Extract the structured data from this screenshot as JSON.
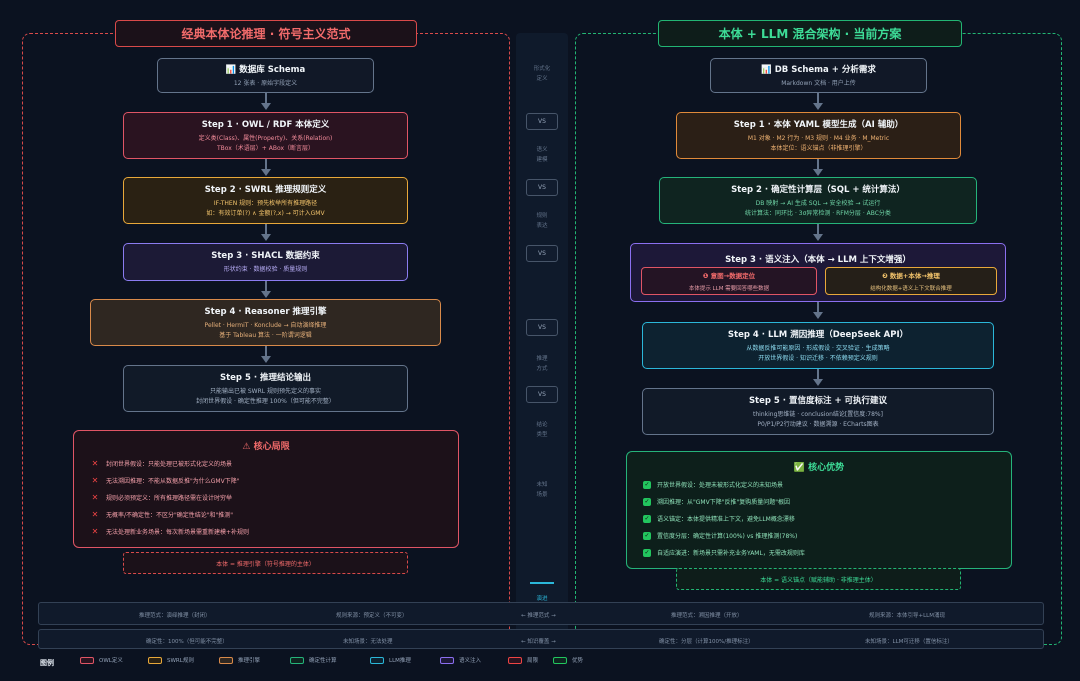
{
  "left": {
    "title": "经典本体论推理 · 符号主义范式",
    "source": {
      "title": "📊 数据库 Schema",
      "sub": "12 张表 · 原始字段定义"
    },
    "steps": [
      {
        "title": "Step 1 · OWL / RDF 本体定义",
        "lines": [
          "定义类(Class)、属性(Property)、关系(Relation)",
          "TBox（术语层）+ ABox（断言层）"
        ]
      },
      {
        "title": "Step 2 · SWRL 推理规则定义",
        "lines": [
          "IF-THEN 规则：预先枚举所有推理路径",
          "如：有效订单(?) ∧ 金额(?,x) → 可计入GMV"
        ]
      },
      {
        "title": "Step 3 · SHACL 数据约束",
        "lines": [
          "形状约束 · 数据校验 · 质量规则"
        ]
      },
      {
        "title": "Step 4 · Reasoner 推理引擎",
        "lines": [
          "Pellet · HermiT · Konclude → 自动演绎推理",
          "基于 Tableau 算法 · 一阶谓词逻辑"
        ]
      },
      {
        "title": "Step 5 · 推理结论输出",
        "lines": [
          "只能输出已被 SWRL 规则预先定义的事实",
          "封闭世界假设 · 确定性推理 100%（但可能不完整）"
        ]
      }
    ],
    "limit": {
      "title": "⚠ 核心局限",
      "items": [
        "封闭世界假设：只能处理已被形式化定义的场景",
        "无法溯因推理：不能从数据反推\"为什么GMV下降\"",
        "规则必须预定义：所有推理路径需在设计时穷举",
        "无概率/不确定性：不区分\"确定性结论\"和\"推测\"",
        "无法处理新业务场景：每次新场景需重新建模+补规则"
      ]
    },
    "footer": "本体 = 推理引擎（符号推理的主体）"
  },
  "right": {
    "title": "本体 + LLM 混合架构 · 当前方案",
    "source": {
      "title": "📊 DB Schema + 分析需求",
      "sub": "Markdown 文档 · 用户上传"
    },
    "steps": [
      {
        "title": "Step 1 · 本体 YAML 模型生成（AI 辅助）",
        "lines": [
          "M1 对象 · M2 行为 · M3 规则 · M4 业务 · M_Metric",
          "本体定位：语义锚点（非推理引擎）"
        ]
      },
      {
        "title": "Step 2 · 确定性计算层（SQL + 统计算法）",
        "lines": [
          "DB 映射 → AI 生成 SQL → 安全校验 → 试运行",
          "统计算法：同环比 · 3σ异常检测 · RFM分层 · ABC分类"
        ]
      },
      {
        "title": "Step 3 · 语义注入（本体 → LLM 上下文增强）"
      },
      {
        "title": "Step 4 · LLM 溯因推理（DeepSeek API）",
        "lines": [
          "从数据反推可能原因 · 形成假设 · 交叉验证 · 生成策略",
          "开放世界假设 · 知识迁移 · 不依赖预定义规则"
        ]
      },
      {
        "title": "Step 5 · 置信度标注 + 可执行建议",
        "lines": [
          "thinking思维链 · conclusion结论[置信度:78%]",
          "P0/P1/P2行动建议 · 数据溯源 · ECharts图表"
        ]
      }
    ],
    "step3_subs": [
      {
        "title": "❶ 意图→数据定位",
        "sub": "本体提示 LLM 需要回答哪些数据"
      },
      {
        "title": "❷ 数据+本体→推理",
        "sub": "结构化数据+语义上下文联合推理"
      }
    ],
    "adv": {
      "title": "✅ 核心优势",
      "items": [
        "开放世界假设：处理未被形式化定义的未知场景",
        "溯因推理：从\"GMV下降\"反推\"复购质量问题\"根因",
        "语义锚定：本体提供精准上下文，避免LLM概念漂移",
        "置信度分层：确定性计算(100%) vs 推理推测(78%)",
        "自适应演进：新场景只需补充业务YAML，无需改规则库"
      ]
    },
    "footer": "本体 = 语义锚点（赋能辅助 · 非推理主体）"
  },
  "vs": {
    "labels": [
      "形式化\n定义",
      "语义\n建模",
      "规则\n表达",
      "推理\n方式",
      "结论\n类型",
      "未知\n场景"
    ],
    "badge": "VS",
    "bottom_label": "演进"
  },
  "compare": {
    "row1": {
      "left_a": "推理范式：演绎推理（封闭）",
      "left_b": "规则来源：预定义（不可变）",
      "mid": "← 推理范式 →",
      "right_a": "推理范式：溯因推理（开放）",
      "right_b": "规则来源：本体引导+LLM涌现"
    },
    "row2": {
      "left_a": "确定性：100%（但可能不完整）",
      "left_b": "未知场景：无法处理",
      "mid": "← 知识覆盖 →",
      "right_a": "确定性：分层（计算100%/推理标注）",
      "right_b": "未知场景：LLM可迁移（置信标注）"
    }
  },
  "legend": {
    "title": "图例",
    "items": [
      {
        "label": "OWL定义",
        "color": "#e05565"
      },
      {
        "label": "SWRL规则",
        "color": "#e8a83a"
      },
      {
        "label": "推理引擎",
        "color": "#d98a4a"
      },
      {
        "label": "确定性计算",
        "color": "#25b37a"
      },
      {
        "label": "LLM推理",
        "color": "#2bb7d9"
      },
      {
        "label": "语义注入",
        "color": "#8b6ff0"
      },
      {
        "label": "局限",
        "color": "#ef4444"
      },
      {
        "label": "优势",
        "color": "#22c55e"
      }
    ]
  }
}
